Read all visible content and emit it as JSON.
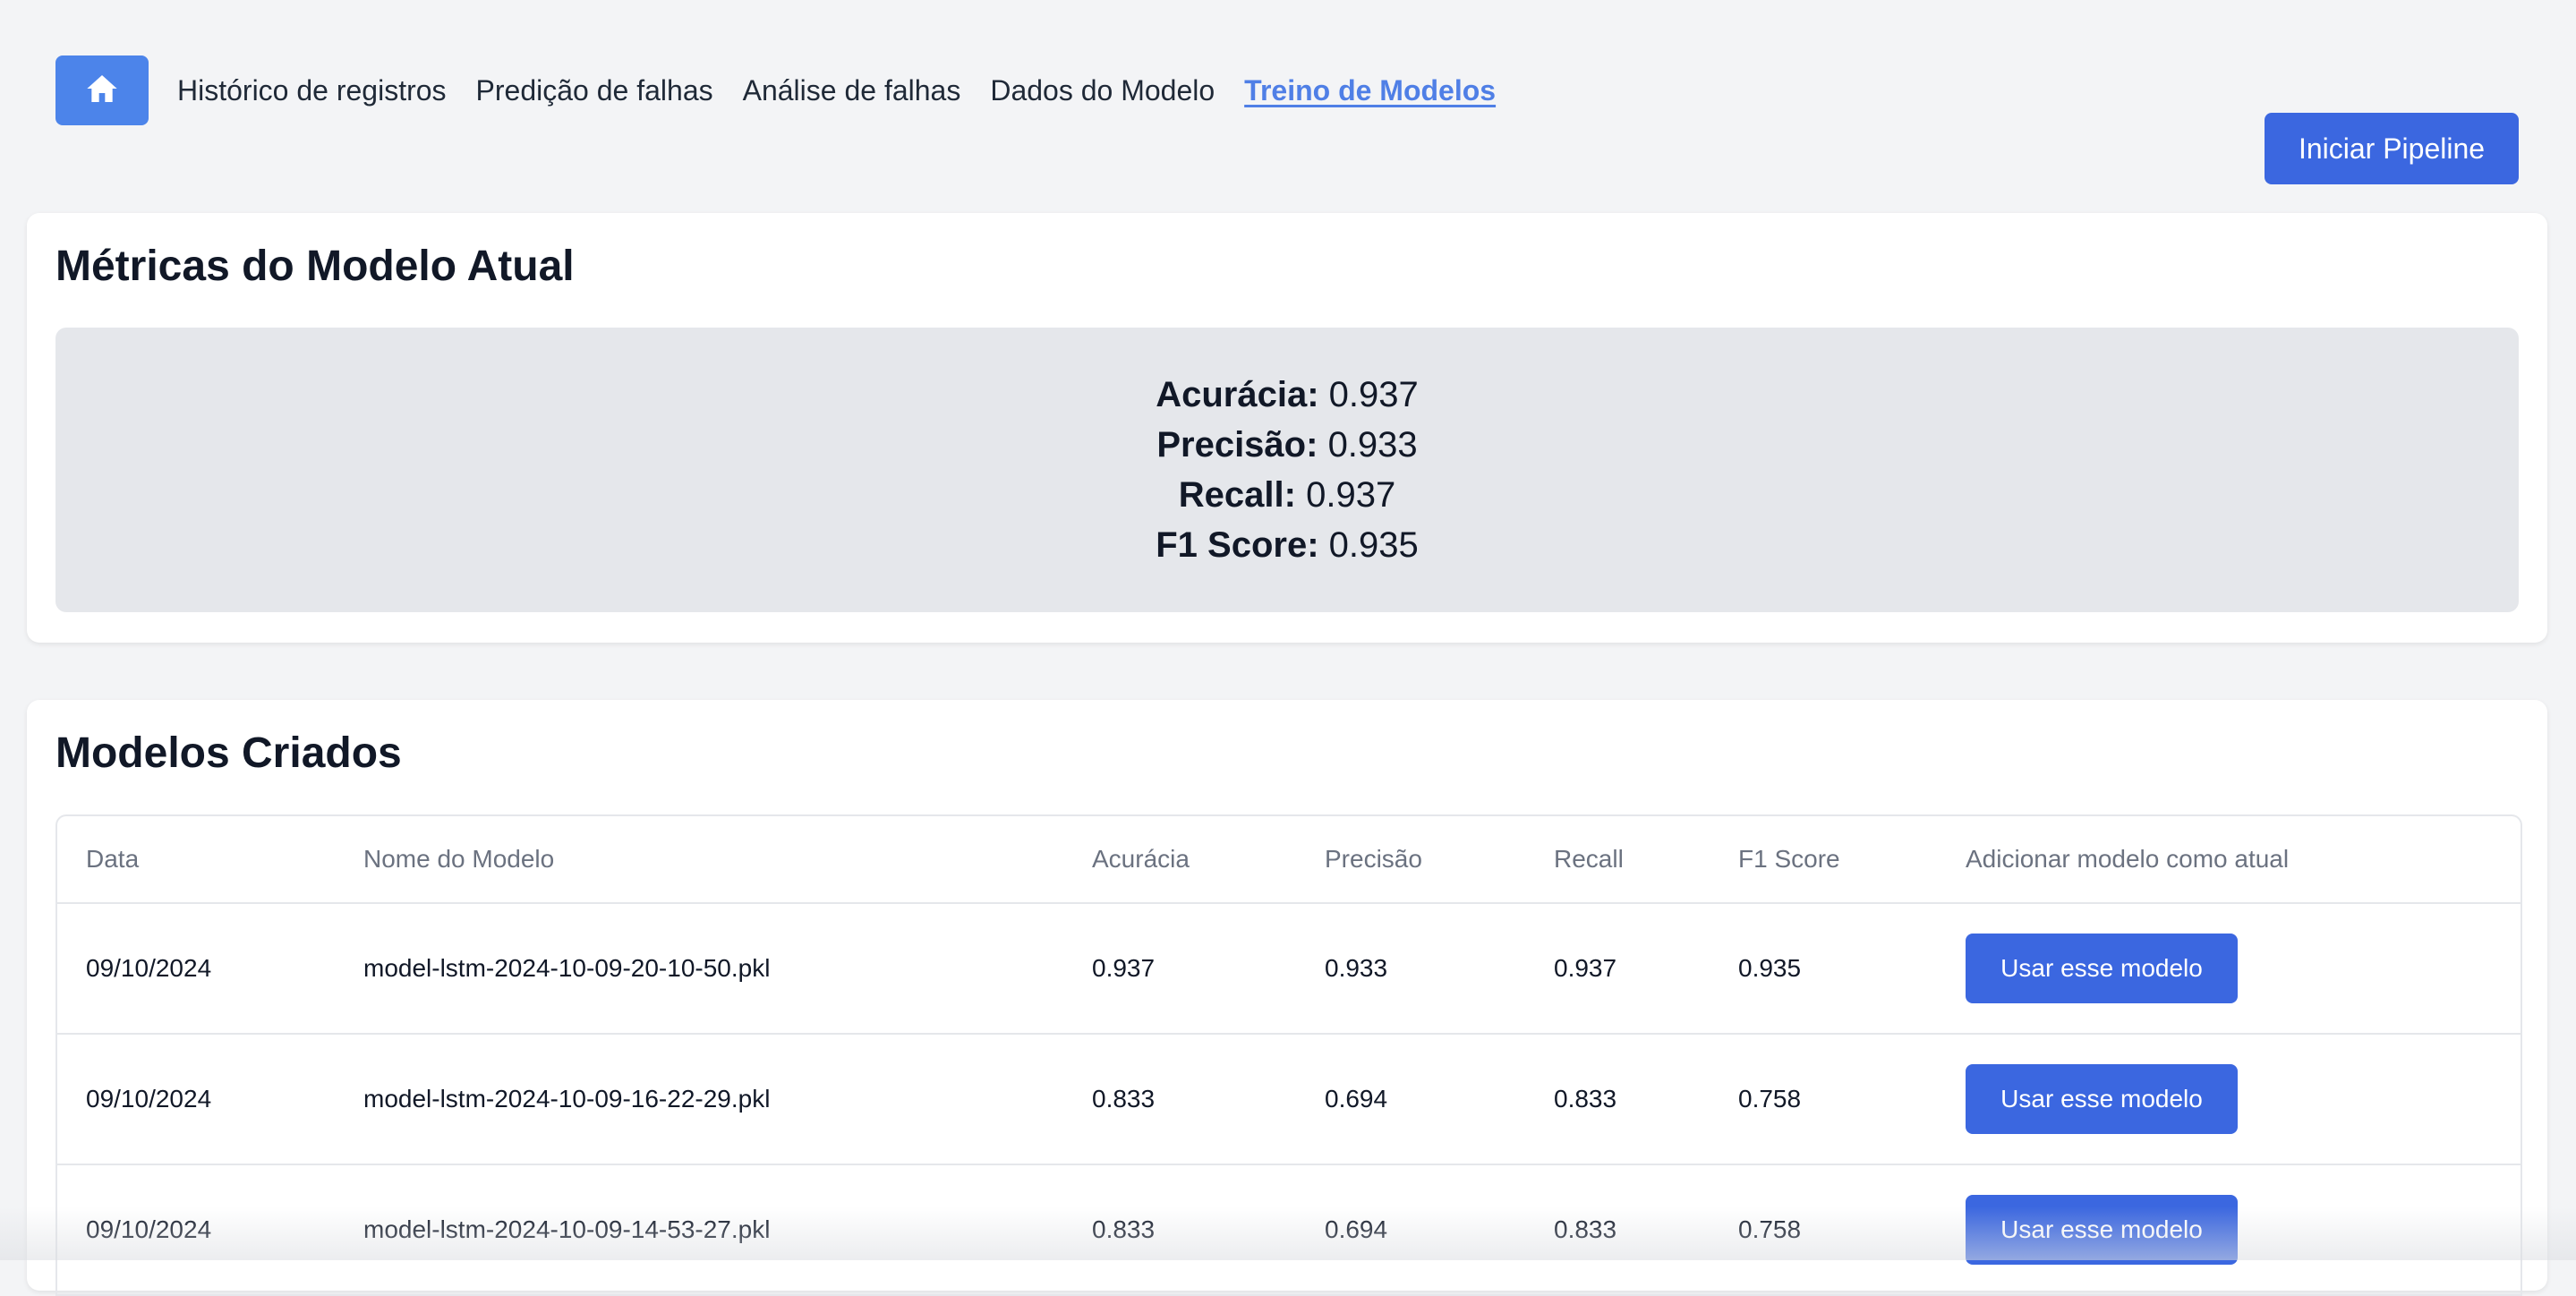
{
  "nav": {
    "home_label": "home",
    "links": [
      {
        "label": "Histórico de registros"
      },
      {
        "label": "Predição de falhas"
      },
      {
        "label": "Análise de falhas"
      },
      {
        "label": "Dados do Modelo"
      },
      {
        "label": "Treino de Modelos",
        "active": true
      }
    ]
  },
  "pipeline_button": "Iniciar Pipeline",
  "metrics": {
    "title": "Métricas do Modelo Atual",
    "items": [
      {
        "label": "Acurácia:",
        "value": "0.937"
      },
      {
        "label": "Precisão:",
        "value": "0.933"
      },
      {
        "label": "Recall:",
        "value": "0.937"
      },
      {
        "label": "F1 Score:",
        "value": "0.935"
      }
    ]
  },
  "models": {
    "title": "Modelos Criados",
    "columns": [
      "Data",
      "Nome do Modelo",
      "Acurácia",
      "Precisão",
      "Recall",
      "F1 Score",
      "Adicionar modelo como atual"
    ],
    "rows": [
      {
        "date": "09/10/2024",
        "name": "model-lstm-2024-10-09-20-10-50.pkl",
        "accuracy": "0.937",
        "precision": "0.933",
        "recall": "0.937",
        "f1": "0.935",
        "action": "Usar esse modelo"
      },
      {
        "date": "09/10/2024",
        "name": "model-lstm-2024-10-09-16-22-29.pkl",
        "accuracy": "0.833",
        "precision": "0.694",
        "recall": "0.833",
        "f1": "0.758",
        "action": "Usar esse modelo"
      },
      {
        "date": "09/10/2024",
        "name": "model-lstm-2024-10-09-14-53-27.pkl",
        "accuracy": "0.833",
        "precision": "0.694",
        "recall": "0.833",
        "f1": "0.758",
        "action": "Usar esse modelo"
      }
    ]
  },
  "colors": {
    "accent": "#3b67e0",
    "home": "#4c84ea",
    "active_link": "#4f7fe6",
    "background": "#f3f4f6"
  }
}
